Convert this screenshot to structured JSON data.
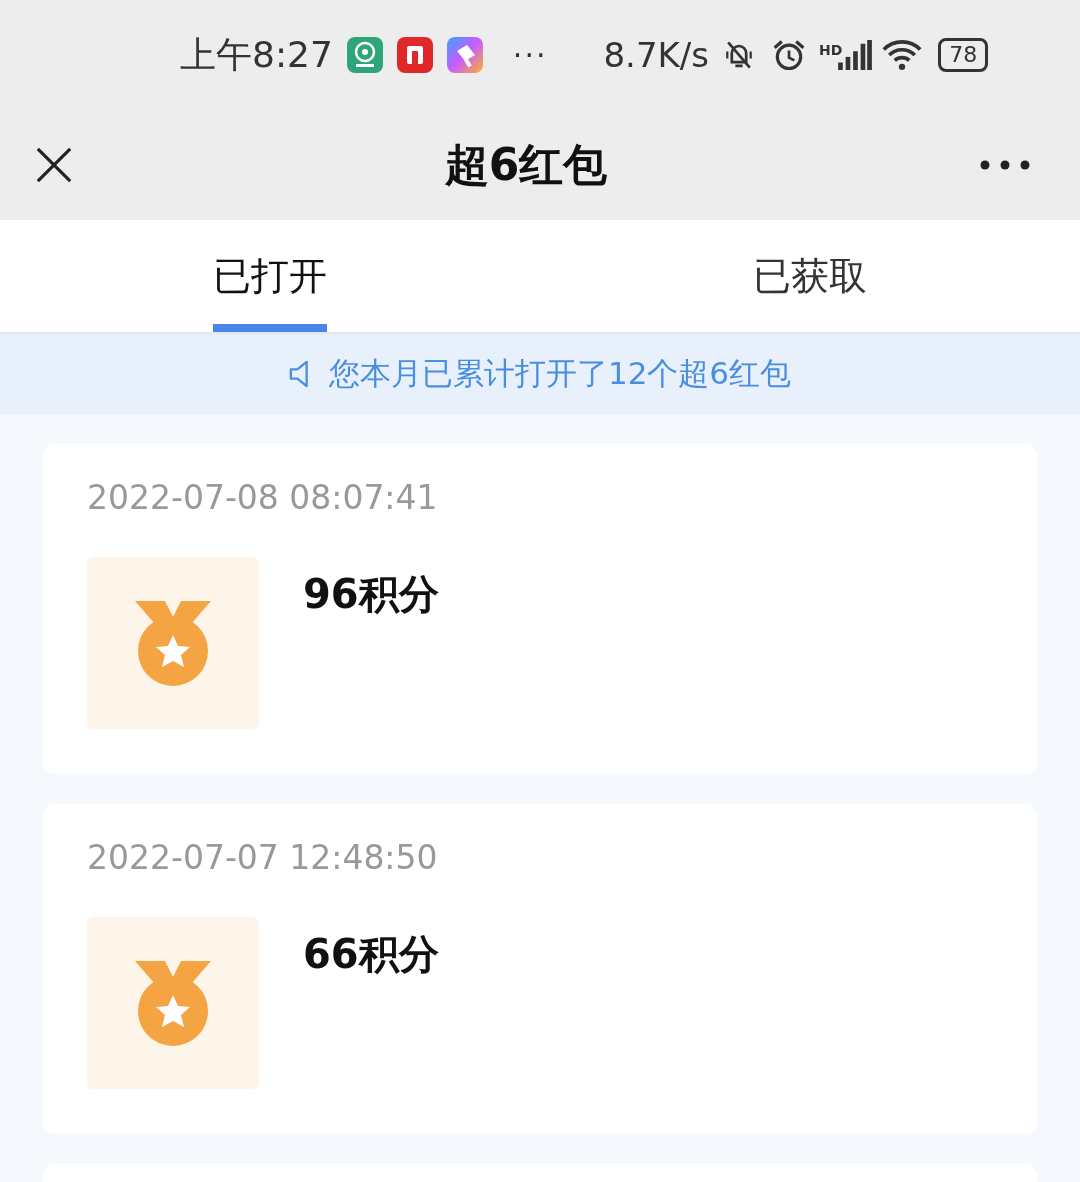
{
  "status_bar": {
    "time": "上午8:27",
    "more": "···",
    "speed": "8.7K/s",
    "signal_label": "HD",
    "battery": "78"
  },
  "header": {
    "title": "超6红包"
  },
  "tabs": [
    {
      "label": "已打开",
      "selected": true
    },
    {
      "label": "已获取",
      "selected": false
    }
  ],
  "notice": "您本月已累计打开了12个超6红包",
  "records": [
    {
      "time": "2022-07-08 08:07:41",
      "reward": "96积分"
    },
    {
      "time": "2022-07-07 12:48:50",
      "reward": "66积分"
    }
  ]
}
